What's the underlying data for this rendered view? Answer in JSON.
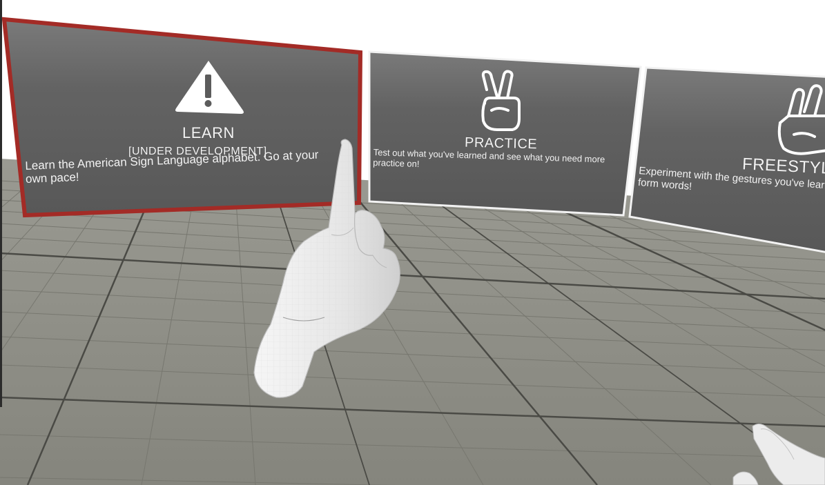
{
  "menu": {
    "panels": [
      {
        "id": "learn",
        "title": "LEARN",
        "subtitle": "[UNDER DEVELOPMENT]",
        "description": "Learn the American Sign Language alphabet. Go at your own pace!",
        "icon": "warning-icon",
        "selected": true
      },
      {
        "id": "practice",
        "title": "PRACTICE",
        "description": "Test out what you've learned and see what you need more practice on!",
        "icon": "peace-sign-hand-icon",
        "selected": false
      },
      {
        "id": "freestyle",
        "title": "FREESTYLE",
        "description": "Experiment with the gestures you've learned and put them together to form words!",
        "icon": "three-fingers-hand-icon",
        "selected": false
      }
    ]
  },
  "colors": {
    "selection_border": "#a32b26",
    "panel_top": "#767676",
    "panel_body": "#5a5a5a",
    "floor": "#8d8d84",
    "grid_line": "#6f6f68",
    "hand": "#ececec"
  }
}
